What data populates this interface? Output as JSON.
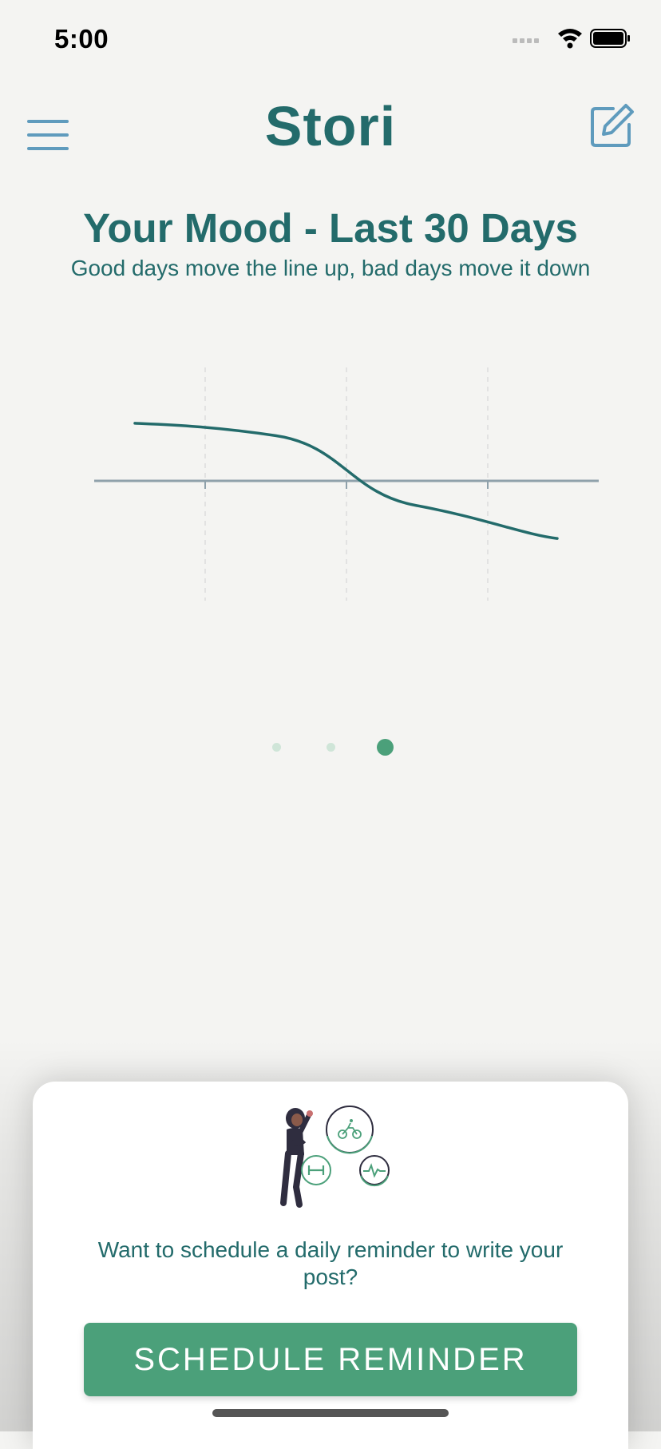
{
  "status_bar": {
    "time": "5:00"
  },
  "header": {
    "title": "Stori"
  },
  "mood_chart": {
    "title": "Your Mood - Last 30 Days",
    "subtitle": "Good days move the line up, bad days move it down"
  },
  "chart_data": {
    "type": "line",
    "title": "Your Mood - Last 30 Days",
    "x": [
      0,
      1,
      2,
      3
    ],
    "series": [
      {
        "values": [
          0.7,
          0.55,
          -0.3,
          -0.7
        ]
      }
    ],
    "ylim": [
      -1,
      1
    ],
    "grid": true
  },
  "pager": {
    "count": 3,
    "active_index": 2
  },
  "reminder_card": {
    "text": "Want to schedule a daily reminder to write your post?",
    "button_label": "SCHEDULE REMINDER"
  },
  "colors": {
    "primary": "#236b6b",
    "accent": "#4ba07a",
    "icon": "#5f9bbd",
    "axis": "#8fa1ab",
    "background": "#f4f4f2"
  }
}
